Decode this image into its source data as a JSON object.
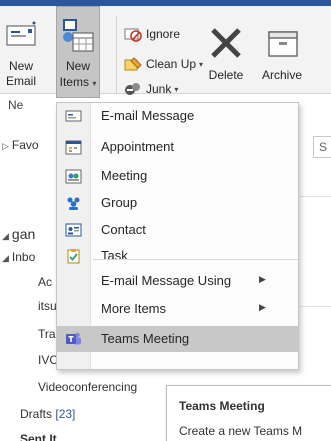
{
  "ribbon": {
    "new_email": {
      "line1": "New",
      "line2": "Email"
    },
    "new_items": {
      "line1": "New",
      "line2": "Items"
    },
    "group_label": "Ne",
    "ignore": "Ignore",
    "clean_up": "Clean Up",
    "junk": "Junk",
    "delete": "Delete",
    "archive": "Archive"
  },
  "folders": {
    "favorites": "Favo",
    "account": "gan",
    "inbox": "Inbo",
    "subfolders": [
      "Ac",
      "itsu",
      "Tra",
      "IVC"
    ],
    "videoconferencing": "Videoconferencing",
    "drafts": {
      "label": "Drafts",
      "count": "[23]"
    },
    "sent_items": "Sent It"
  },
  "search_stub": "S",
  "menu": {
    "items": [
      {
        "label": "E-mail Message",
        "icon": "email-message-icon"
      },
      {
        "label": "Appointment",
        "icon": "appointment-icon"
      },
      {
        "label": "Meeting",
        "icon": "meeting-icon"
      },
      {
        "label": "Group",
        "icon": "group-icon"
      },
      {
        "label": "Contact",
        "icon": "contact-icon"
      },
      {
        "label": "Task",
        "icon": "task-icon"
      },
      {
        "label": "E-mail Message Using",
        "icon": ""
      },
      {
        "label": "More Items",
        "icon": ""
      },
      {
        "label": "Teams Meeting",
        "icon": "teams-icon"
      }
    ],
    "highlighted": "Teams Meeting"
  },
  "tooltip": {
    "title": "Teams Meeting",
    "description": "Create a new Teams M"
  },
  "colors": {
    "accent": "#2b579a",
    "teams": "#5059c9",
    "highlight": "#c8c8c8"
  }
}
